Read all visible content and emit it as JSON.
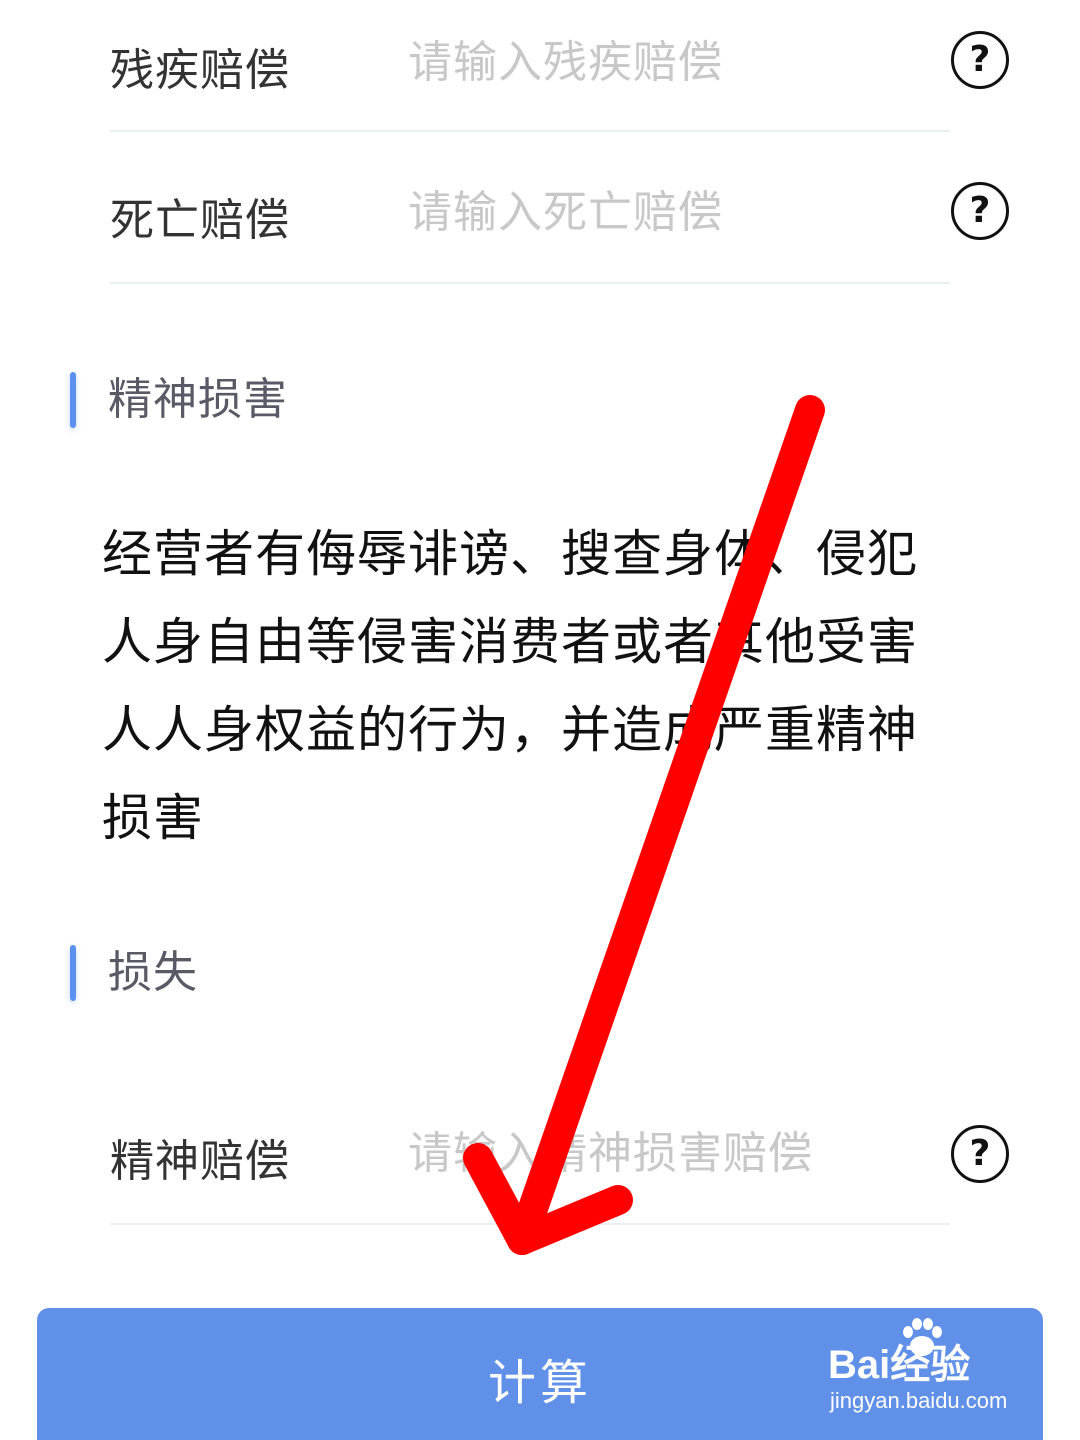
{
  "fields": [
    {
      "label": "残疾赔偿",
      "placeholder": "请输入残疾赔偿",
      "value": ""
    },
    {
      "label": "死亡赔偿",
      "placeholder": "请输入死亡赔偿",
      "value": ""
    },
    {
      "label": "精神赔偿",
      "placeholder": "请输入精神损害赔偿",
      "value": ""
    }
  ],
  "help_icon": {
    "glyph": "?",
    "icon": "question-circle-icon"
  },
  "sections": {
    "mental_damage": {
      "title": "精神损害"
    },
    "loss": {
      "title": "损失"
    }
  },
  "description": "经营者有侮辱诽谤、搜查身体、侵犯人身自由等侵害消费者或者其他受害人人身权益的行为，并造成严重精神损害",
  "button": {
    "label": "计算"
  },
  "watermark": {
    "brand": "Bai经验",
    "url": "jingyan.baidu.com"
  },
  "colors": {
    "accent": "#6190e8",
    "section_bar": "#5b8ff0",
    "placeholder": "#c8c8c8",
    "annotation_arrow": "#ff0000"
  }
}
